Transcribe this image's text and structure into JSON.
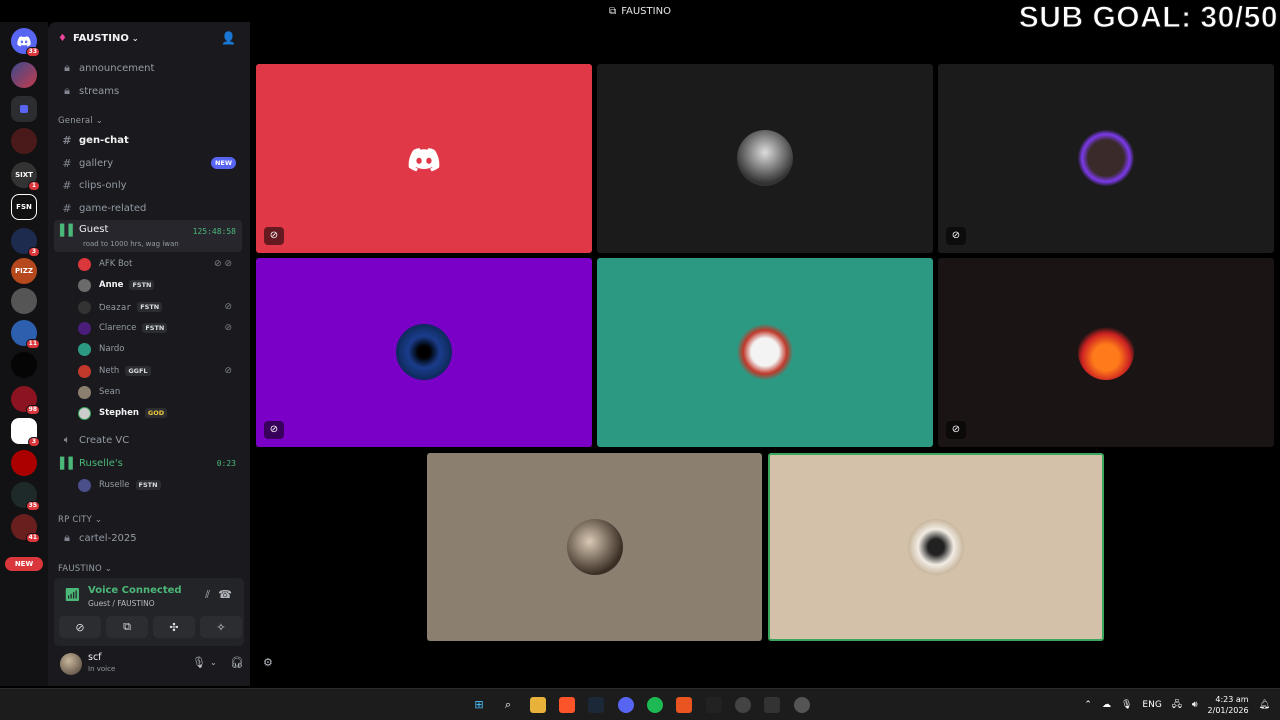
{
  "window": {
    "title": "FAUSTINO"
  },
  "overlay": {
    "sub_goal": "SUB GOAL: 30/50"
  },
  "rail": {
    "badges": [
      "33",
      "1",
      "3",
      "11",
      "98",
      "3",
      "35",
      "41"
    ],
    "new_label": "NEW"
  },
  "server": {
    "name": "FAUSTINO"
  },
  "channels": {
    "top": [
      "announcement",
      "streams"
    ],
    "general_label": "General",
    "general": [
      {
        "name": "gen-chat"
      },
      {
        "name": "gallery",
        "badge": "NEW"
      },
      {
        "name": "clips-only"
      },
      {
        "name": "game-related"
      }
    ],
    "guest": {
      "name": "Guest",
      "timer": "125:48:58",
      "status": "road to 1000 hrs, wag iwan"
    },
    "guest_users": [
      {
        "name": "AFK Bot",
        "tag": ""
      },
      {
        "name": "Anne",
        "tag": "FSTN"
      },
      {
        "name": "Ꝺeazar",
        "tag": "FSTN"
      },
      {
        "name": "Clarence",
        "tag": "FSTN"
      },
      {
        "name": "Nardo",
        "tag": ""
      },
      {
        "name": "Neth",
        "tag": "GGFL"
      },
      {
        "name": "Sean",
        "tag": ""
      },
      {
        "name": "Stephen",
        "tag": "GOD"
      }
    ],
    "create_vc": "Create VC",
    "ruselle": {
      "name": "Ruselle's",
      "timer": "0:23"
    },
    "ruselle_users": [
      {
        "name": "Ruselle",
        "tag": "FSTN"
      }
    ],
    "rp_label": "RP CITY",
    "rp": [
      "cartel-2025"
    ],
    "faustino_label": "FAUSTINO"
  },
  "voice": {
    "status": "Voice Connected",
    "location": "Guest / FAUSTINO"
  },
  "user": {
    "name": "scf",
    "status": "In voice"
  },
  "colors": {
    "tile_red": "#e13847",
    "tile_purple": "#7b00c7",
    "tile_teal": "#2c9a83",
    "tile_taupe": "#8b8070",
    "tile_beige": "#d4c1a9",
    "tile_dark": "#1b1b1b",
    "speaking": "#3ba55c",
    "online": "#4bb879",
    "blurple": "#5865f2"
  },
  "taskbar": {
    "lang": "ENG",
    "time": "4:23 am",
    "date": "2/01/2026"
  }
}
